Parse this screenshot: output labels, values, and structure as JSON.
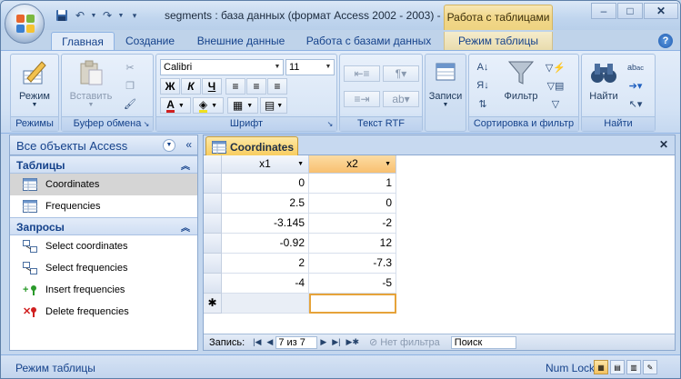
{
  "window": {
    "title": "segments : база данных (формат Access 2002 - 2003) -",
    "context_title": "Работа с таблицами",
    "minimize": "–",
    "maximize": "□",
    "close": "✕"
  },
  "ribbon_tabs": [
    "Главная",
    "Создание",
    "Внешние данные",
    "Работа с базами данных",
    "Режим таблицы"
  ],
  "help": "?",
  "groups": {
    "views": {
      "label": "Режимы",
      "button": "Режим"
    },
    "clipboard": {
      "label": "Буфер обмена",
      "button": "Вставить"
    },
    "font": {
      "label": "Шрифт",
      "font_name": "Calibri",
      "font_size": "11",
      "bold": "Ж",
      "italic": "К",
      "underline": "Ч"
    },
    "rtf": {
      "label": "Текст RTF"
    },
    "records": {
      "button": "Записи"
    },
    "sort": {
      "label": "Сортировка и фильтр",
      "button": "Фильтр"
    },
    "find": {
      "label": "Найти",
      "button": "Найти"
    }
  },
  "nav": {
    "title": "Все объекты Access",
    "sections": [
      {
        "name": "Таблицы",
        "items": [
          "Coordinates",
          "Frequencies"
        ]
      },
      {
        "name": "Запросы",
        "items": [
          "Select coordinates",
          "Select frequencies",
          "Insert frequencies",
          "Delete frequencies"
        ]
      }
    ]
  },
  "document": {
    "tab": "Coordinates",
    "columns": [
      "x1",
      "x2"
    ],
    "rows": [
      [
        "0",
        "1"
      ],
      [
        "2.5",
        "0"
      ],
      [
        "-3.145",
        "-2"
      ],
      [
        "-0.92",
        "12"
      ],
      [
        "2",
        "-7.3"
      ],
      [
        "-4",
        "-5"
      ]
    ],
    "new_row_marker": "✱",
    "record_nav": {
      "label": "Запись:",
      "current": "7 из 7",
      "filter": "Нет фильтра",
      "search": "Поиск"
    }
  },
  "status": {
    "left": "Режим таблицы",
    "right": "Num Lock"
  },
  "colors": {
    "accent": "#15428b",
    "selected_column": "#f8c070",
    "doc_tab": "#f8cc5c"
  }
}
